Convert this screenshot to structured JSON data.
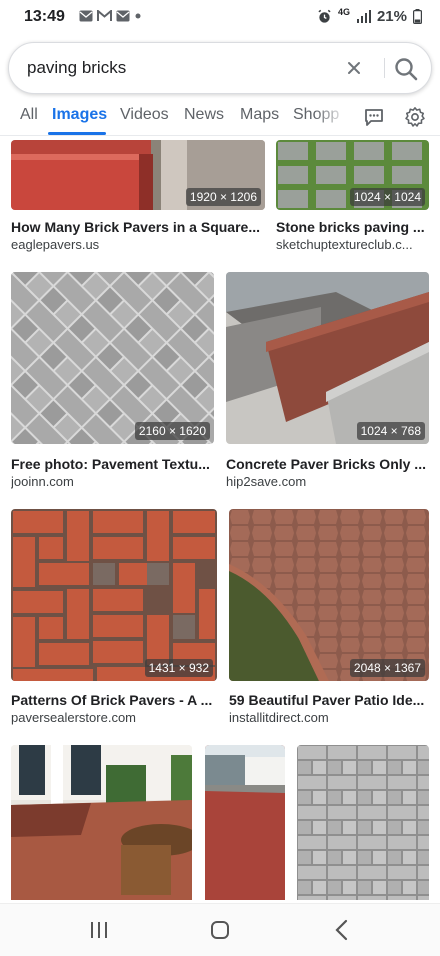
{
  "status": {
    "time": "13:49",
    "battery": "21%",
    "network": "4G"
  },
  "search": {
    "query": "paving bricks"
  },
  "tabs": [
    {
      "label": "All"
    },
    {
      "label": "Images"
    },
    {
      "label": "Videos"
    },
    {
      "label": "News"
    },
    {
      "label": "Maps"
    },
    {
      "label": "Shopp"
    }
  ],
  "results": [
    {
      "title": "How Many Brick Pavers in a Square...",
      "source": "eaglepavers.us",
      "dims": "1920 × 1206"
    },
    {
      "title": "Stone bricks paving ...",
      "source": "sketchuptextureclub.c...",
      "dims": "1024 × 1024"
    },
    {
      "title": "Free photo: Pavement Textu...",
      "source": "jooinn.com",
      "dims": "2160 × 1620"
    },
    {
      "title": "Concrete Paver Bricks Only ...",
      "source": "hip2save.com",
      "dims": "1024 × 768"
    },
    {
      "title": "Patterns Of Brick Pavers - A ...",
      "source": "paversealerstore.com",
      "dims": "1431 × 932"
    },
    {
      "title": "59 Beautiful Paver Patio Ide...",
      "source": "installitdirect.com",
      "dims": "2048 × 1367"
    }
  ],
  "colors": {
    "accent": "#1a73e8",
    "text": "#202124",
    "secondary": "#5f6368"
  }
}
